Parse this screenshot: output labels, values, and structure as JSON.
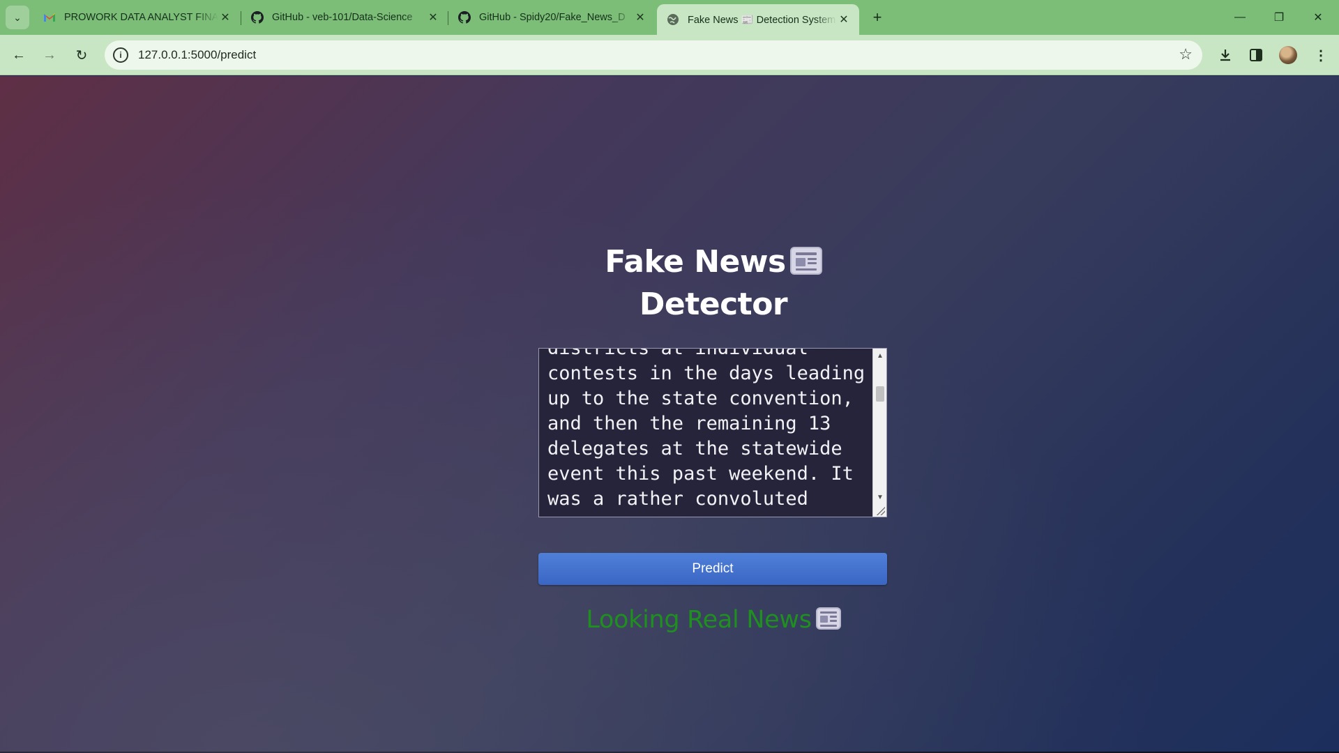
{
  "browser": {
    "tabs": [
      {
        "title": "PROWORK DATA ANALYST FINAL",
        "favicon": "gmail-icon",
        "close": "✕"
      },
      {
        "title": "GitHub - veb-101/Data-Science",
        "favicon": "github-icon",
        "close": "✕"
      },
      {
        "title": "GitHub - Spidy20/Fake_News_D",
        "favicon": "github-icon",
        "close": "✕"
      },
      {
        "title": "Fake News 📰 Detection System",
        "favicon": "globe-icon",
        "close": "✕",
        "active": true
      }
    ],
    "new_tab": "+",
    "url": "127.0.0.1:5000/predict",
    "window_controls": {
      "minimize": "—",
      "restore": "❐",
      "close": "✕"
    }
  },
  "page": {
    "title_line1": "Fake News",
    "title_line2": "Detector",
    "article_text": "districts at individual contests in the days leading up to the state convention, and then the remaining 13 delegates at the statewide event this past weekend. It was a rather convoluted process",
    "predict_label": "Predict",
    "result_text": "Looking Real News"
  },
  "colors": {
    "tabbar": "#7cbd78",
    "toolbar": "#c9e6c4",
    "button": "#4274d0",
    "result": "#1f8f1f"
  }
}
